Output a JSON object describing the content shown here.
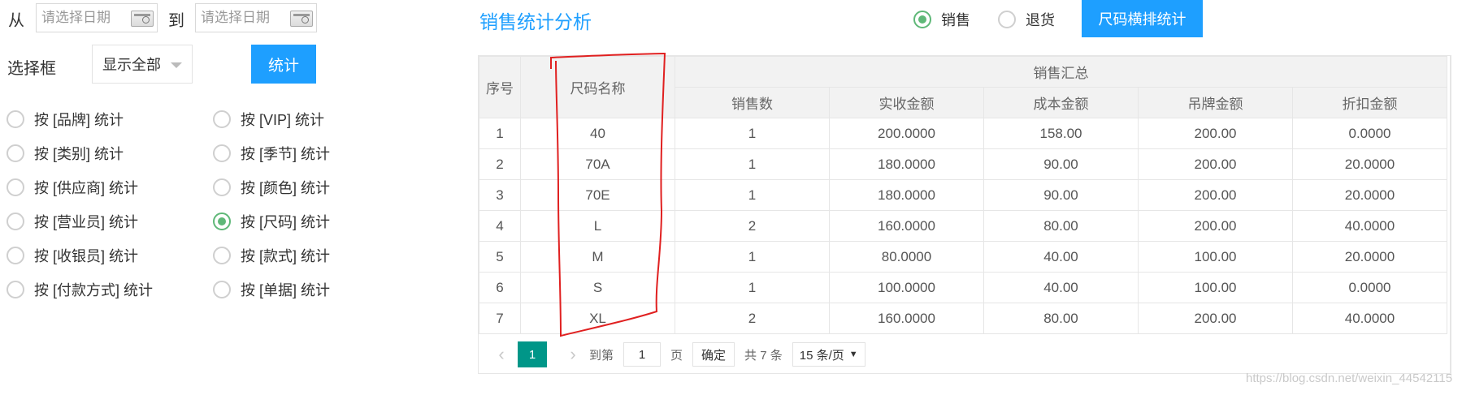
{
  "filters": {
    "from_label": "从",
    "to_label": "到",
    "start_date_placeholder": "请选择日期",
    "end_date_placeholder": "请选择日期",
    "select_label": "选择框",
    "select_value": "显示全部",
    "stat_button": "统计",
    "radios_left": [
      {
        "label": "按 [品牌] 统计",
        "checked": false
      },
      {
        "label": "按 [类别] 统计",
        "checked": false
      },
      {
        "label": "按 [供应商] 统计",
        "checked": false
      },
      {
        "label": "按 [营业员] 统计",
        "checked": false
      },
      {
        "label": "按 [收银员] 统计",
        "checked": false
      },
      {
        "label": "按 [付款方式] 统计",
        "checked": false
      }
    ],
    "radios_right": [
      {
        "label": "按 [VIP] 统计",
        "checked": false
      },
      {
        "label": "按 [季节] 统计",
        "checked": false
      },
      {
        "label": "按 [颜色] 统计",
        "checked": false
      },
      {
        "label": "按 [尺码] 统计",
        "checked": true
      },
      {
        "label": "按 [款式] 统计",
        "checked": false
      },
      {
        "label": "按 [单据] 统计",
        "checked": false
      }
    ]
  },
  "header": {
    "title": "销售统计分析",
    "type_options": [
      {
        "label": "销售",
        "checked": true
      },
      {
        "label": "退货",
        "checked": false
      }
    ],
    "size_stat_button": "尺码横排统计"
  },
  "table": {
    "col_index": "序号",
    "col_size": "尺码名称",
    "group_header": "销售汇总",
    "sub_columns": [
      "销售数",
      "实收金额",
      "成本金额",
      "吊牌金额",
      "折扣金额"
    ],
    "rows": [
      [
        "1",
        "40",
        "1",
        "200.0000",
        "158.00",
        "200.00",
        "0.0000"
      ],
      [
        "2",
        "70A",
        "1",
        "180.0000",
        "90.00",
        "200.00",
        "20.0000"
      ],
      [
        "3",
        "70E",
        "1",
        "180.0000",
        "90.00",
        "200.00",
        "20.0000"
      ],
      [
        "4",
        "L",
        "2",
        "160.0000",
        "80.00",
        "200.00",
        "40.0000"
      ],
      [
        "5",
        "M",
        "1",
        "80.0000",
        "40.00",
        "100.00",
        "20.0000"
      ],
      [
        "6",
        "S",
        "1",
        "100.0000",
        "40.00",
        "100.00",
        "0.0000"
      ],
      [
        "7",
        "XL",
        "2",
        "160.0000",
        "80.00",
        "200.00",
        "40.0000"
      ]
    ]
  },
  "pager": {
    "current_page": "1",
    "goto_label": "到第",
    "goto_value": "1",
    "page_unit": "页",
    "confirm": "确定",
    "total": "共 7 条",
    "page_size": "15 条/页"
  },
  "annotation_color": "#e02020",
  "watermark": "https://blog.csdn.net/weixin_44542115"
}
